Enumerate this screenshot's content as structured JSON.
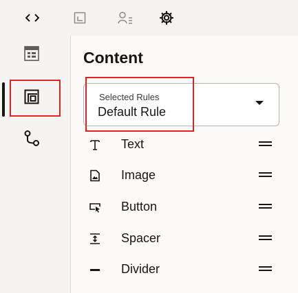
{
  "toolbar": {
    "icons": [
      "code-icon",
      "layout-icon",
      "users-settings-icon",
      "gear-icon"
    ]
  },
  "left_rail": {
    "items": [
      {
        "name": "data-icon",
        "active": false
      },
      {
        "name": "layout-block-icon",
        "active": true
      },
      {
        "name": "workflow-icon",
        "active": false
      }
    ]
  },
  "panel": {
    "title": "Content",
    "selected_rules": {
      "label": "Selected Rules",
      "value": "Default Rule"
    },
    "items": [
      {
        "label": "Text",
        "icon": "text-icon"
      },
      {
        "label": "Image",
        "icon": "image-icon"
      },
      {
        "label": "Button",
        "icon": "button-icon"
      },
      {
        "label": "Spacer",
        "icon": "spacer-icon"
      },
      {
        "label": "Divider",
        "icon": "divider-icon"
      }
    ]
  },
  "colors": {
    "highlight": "#e0231e",
    "text": "#161513"
  }
}
